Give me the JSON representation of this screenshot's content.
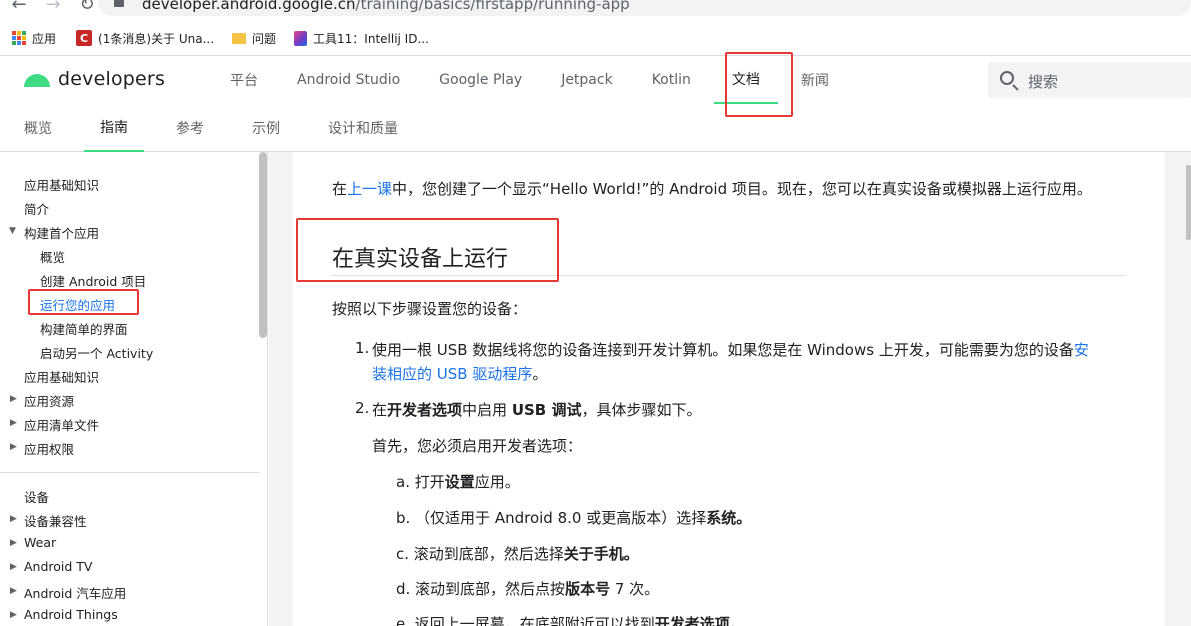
{
  "browser": {
    "url_domain": "developer.android.google.cn",
    "url_path": "/training/basics/firstapp/running-app",
    "bookmarks": [
      {
        "label": "应用"
      },
      {
        "label": "(1条消息)关于 Una..."
      },
      {
        "label": "问题"
      },
      {
        "label": "工具11：Intellij ID..."
      }
    ]
  },
  "header": {
    "logo_text": "developers",
    "nav": [
      "平台",
      "Android Studio",
      "Google Play",
      "Jetpack",
      "Kotlin",
      "文档",
      "新闻"
    ],
    "search_placeholder": "搜索"
  },
  "subnav": [
    "概览",
    "指南",
    "参考",
    "示例",
    "设计和质量"
  ],
  "sidebar": {
    "items": [
      "应用基础知识",
      "简介",
      "构建首个应用",
      "概览",
      "创建 Android 项目",
      "运行您的应用",
      "构建简单的界面",
      "启动另一个 Activity",
      "应用基础知识",
      "应用资源",
      "应用清单文件",
      "应用权限",
      "设备",
      "设备兼容性",
      "Wear",
      "Android TV",
      "Android 汽车应用",
      "Android Things"
    ]
  },
  "content": {
    "intro_prefix": "在",
    "intro_link": "上一课",
    "intro_suffix": "中，您创建了一个显示“Hello World!”的 Android 项目。现在，您可以在真实设备或模拟器上运行应用。",
    "heading": "在真实设备上运行",
    "setup": "按照以下步骤设置您的设备：",
    "step1_num": "1.",
    "step1_text": "使用一根 USB 数据线将您的设备连接到开发计算机。如果您是在 Windows 上开发，可能需要为您的设备",
    "step1_link_a": "安",
    "step1_link_b": "装相应的 USB 驱动程序",
    "step1_end": "。",
    "step2_num": "2.",
    "step2_a": "在",
    "step2_b": "开发者选项",
    "step2_c": "中启用 ",
    "step2_d": "USB 调试",
    "step2_e": "，具体步骤如下。",
    "first": "首先，您必须启用开发者选项：",
    "sub_a_pre": "a. 打开",
    "sub_a_bold": "设置",
    "sub_a_post": "应用。",
    "sub_b_pre": "b. （仅适用于 Android 8.0 或更高版本）选择",
    "sub_b_bold": "系统。",
    "sub_c_pre": "c. 滚动到底部，然后选择",
    "sub_c_bold": "关于手机。",
    "sub_d_pre": "d. 滚动到底部，然后点按",
    "sub_d_bold": "版本号",
    "sub_d_post": " 7 次。",
    "sub_e_pre": "e. 返回上一屏幕，在底部附近可以找到",
    "sub_e_bold": "开发者选项",
    "sub_e_post": "。"
  },
  "colors": {
    "accent_green": "#3ddc84",
    "link_blue": "#1a73e8",
    "annotation_red": "#e53935"
  }
}
